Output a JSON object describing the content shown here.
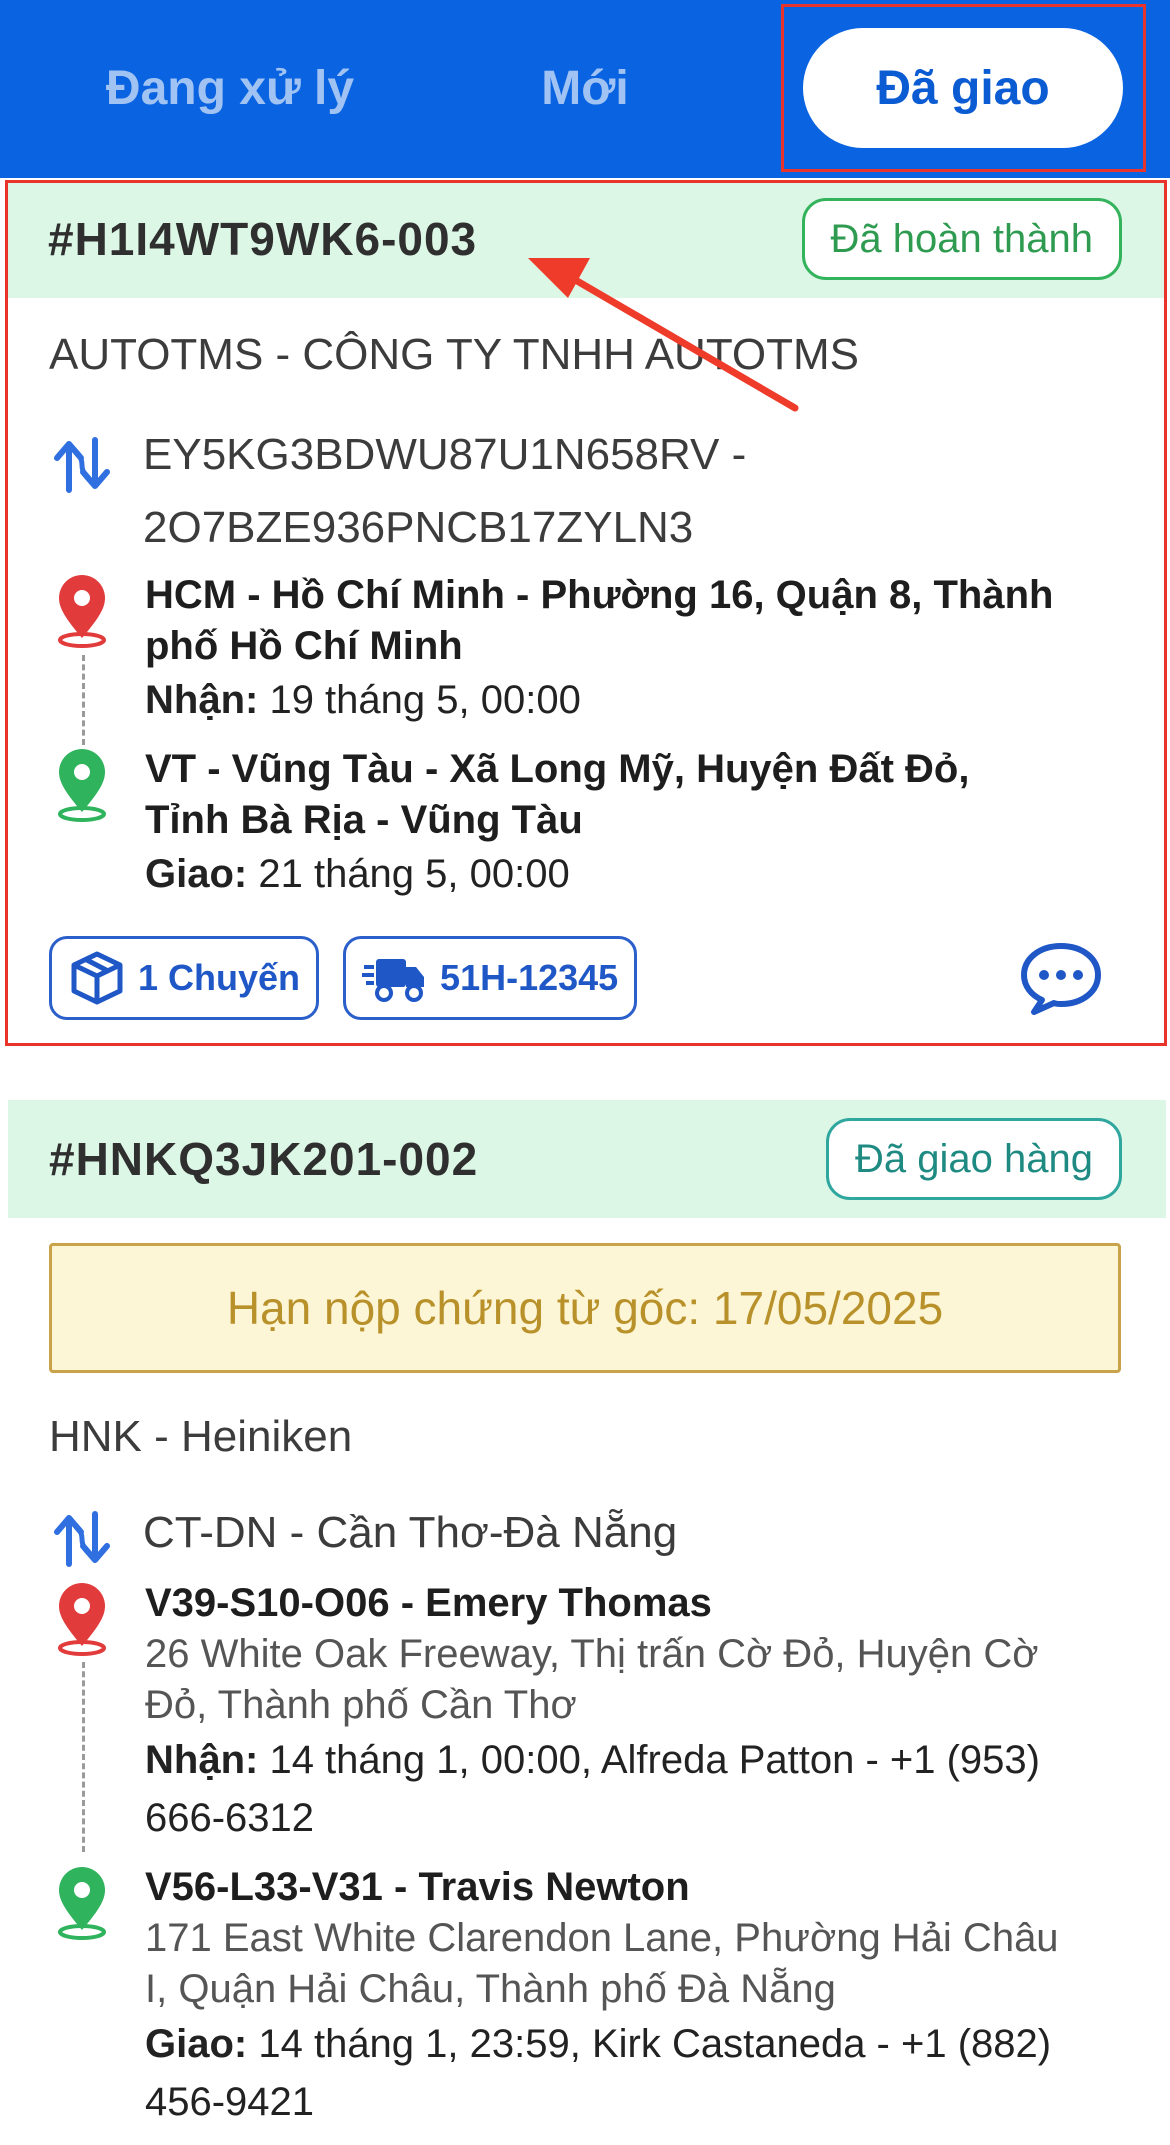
{
  "tabs": [
    {
      "label": "Đang xử lý",
      "active": false
    },
    {
      "label": "Mới",
      "active": false
    },
    {
      "label": "Đã giao",
      "active": true
    }
  ],
  "orders": [
    {
      "id": "#H1I4WT9WK6-003",
      "status": "Đã hoàn thành",
      "company": "AUTOTMS - CÔNG TY TNHH AUTOTMS",
      "route_line1": "EY5KG3BDWU87U1N658RV -",
      "route_line2": "2O7BZE936PNCB17ZYLN3",
      "pickup": {
        "title_line1": "HCM - Hồ Chí Minh - Phường 16, Quận 8, Thành",
        "title_line2": "phố Hồ Chí Minh",
        "time_label": "Nhận:",
        "time": " 19 tháng 5, 00:00"
      },
      "delivery": {
        "title_line1": "VT - Vũng Tàu - Xã Long Mỹ, Huyện Đất Đỏ,",
        "title_line2": "Tỉnh Bà Rịa - Vũng Tàu",
        "time_label": "Giao:",
        "time": " 21 tháng 5, 00:00"
      },
      "trips": "1 Chuyến",
      "plate": "51H-12345"
    },
    {
      "id": "#HNKQ3JK201-002",
      "status": "Đã giao hàng",
      "deadline": "Hạn nộp chứng từ gốc: 17/05/2025",
      "company": "HNK - Heiniken",
      "route": "CT-DN - Cần Thơ-Đà Nẵng",
      "pickup": {
        "title": "V39-S10-O06 - Emery Thomas",
        "addr_line1": "26 White Oak Freeway, Thị trấn Cờ Đỏ, Huyện Cờ",
        "addr_line2": "Đỏ, Thành phố Cần Thơ",
        "time_label": "Nhận:",
        "time_line1": " 14 tháng 1, 00:00, Alfreda Patton - +1 (953)",
        "time_line2": "666-6312"
      },
      "delivery": {
        "title": "V56-L33-V31 - Travis Newton",
        "addr_line1": "171 East White Clarendon Lane, Phường Hải Châu",
        "addr_line2": "I, Quận Hải Châu, Thành phố Đà Nẵng",
        "time_label": "Giao:",
        "time_line1": " 14 tháng 1, 23:59, Kirk Castaneda - +1 (882)",
        "time_line2": "456-9421"
      }
    }
  ],
  "colors": {
    "header_blue": "#0a63e0",
    "highlight_red": "#e8342a",
    "done_green": "#34b35d",
    "shipped_teal": "#2fa79e",
    "deadline_gold": "#b8912b"
  },
  "icons": [
    "route-swap-icon",
    "pickup-pin-icon",
    "delivery-pin-icon",
    "package-icon",
    "truck-icon",
    "chat-icon",
    "annotation-arrow"
  ]
}
